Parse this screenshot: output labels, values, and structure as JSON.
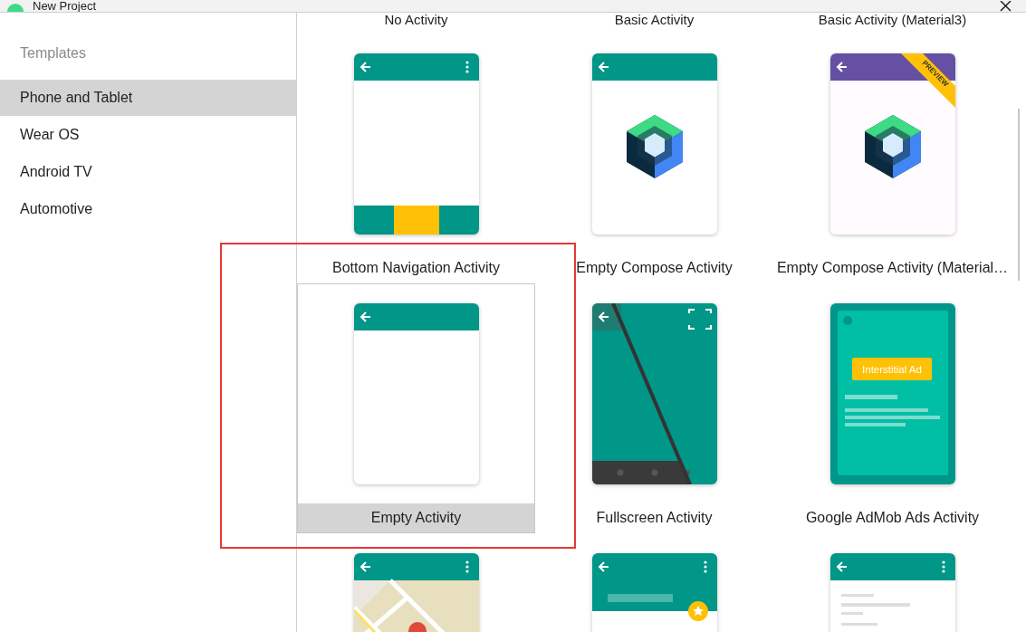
{
  "window": {
    "title": "New Project"
  },
  "sidebar": {
    "heading": "Templates",
    "items": [
      {
        "label": "Phone and Tablet",
        "selected": true
      },
      {
        "label": "Wear OS",
        "selected": false
      },
      {
        "label": "Android TV",
        "selected": false
      },
      {
        "label": "Automotive",
        "selected": false
      }
    ]
  },
  "top_labels": [
    "No Activity",
    "Basic Activity",
    "Basic Activity (Material3)"
  ],
  "templates": [
    {
      "kind": "bottom_nav",
      "label": "Bottom Navigation Activity",
      "selected": false
    },
    {
      "kind": "compose",
      "label": "Empty Compose Activity",
      "selected": false
    },
    {
      "kind": "compose_m3",
      "label": "Empty Compose Activity (Material…",
      "badge": "PREVIEW",
      "selected": false
    },
    {
      "kind": "empty",
      "label": "Empty Activity",
      "selected": true
    },
    {
      "kind": "fullscreen",
      "label": "Fullscreen Activity",
      "selected": false
    },
    {
      "kind": "admob",
      "label": "Google AdMob Ads Activity",
      "ad_text": "Interstitial Ad",
      "selected": false
    },
    {
      "kind": "maps",
      "selected": false
    },
    {
      "kind": "scrolling",
      "selected": false
    },
    {
      "kind": "settings",
      "selected": false
    }
  ],
  "annotation": {
    "kind": "box"
  }
}
